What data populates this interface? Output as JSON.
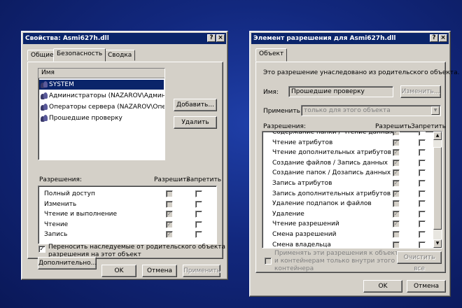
{
  "props_window": {
    "title": "Свойства: Asmi627h.dll",
    "title_buttons": [
      "?",
      "×"
    ],
    "tabs": [
      "Общие",
      "Безопасность",
      "Сводка"
    ],
    "active_tab": "Безопасность",
    "list_header": "Имя",
    "users": [
      "SYSTEM",
      "Администраторы (NAZAROV\\Администра...",
      "Операторы сервера (NAZAROV\\Оператор...",
      "Прошедшие проверку"
    ],
    "selected_user": "SYSTEM",
    "add_button": "Добавить...",
    "remove_button": "Удалить",
    "perm_label": "Разрешения:",
    "allow_label": "Разрешить",
    "deny_label": "Запретить",
    "permissions": [
      {
        "name": "Полный доступ",
        "allow": false,
        "deny": false
      },
      {
        "name": "Изменить",
        "allow": false,
        "deny": false
      },
      {
        "name": "Чтение и выполнение",
        "allow": true,
        "deny": false
      },
      {
        "name": "Чтение",
        "allow": true,
        "deny": false
      },
      {
        "name": "Запись",
        "allow": true,
        "deny": false
      }
    ],
    "advanced_button": "Дополнительно...",
    "inherit_text_line1": "Переносить наследуемые от родительского объекта",
    "inherit_text_line2": "разрешения на этот объект",
    "inherit_checked": true,
    "ok": "OK",
    "cancel": "Отмена",
    "apply": "Применить"
  },
  "perm_window": {
    "title": "Элемент разрешения для Asmi627h.dll",
    "title_buttons": [
      "?",
      "×"
    ],
    "tab": "Объект",
    "inherited_note": "Это разрешение унаследовано из родительского объекта.",
    "name_label": "Имя:",
    "name_value": "Прошедшие проверку",
    "change_button": "Изменить...",
    "apply_to_label": "Применить:",
    "apply_to_value": "только для этого объекта",
    "perm_label": "Разрешения:",
    "allow_label": "Разрешить",
    "deny_label": "Запретить",
    "permissions": [
      {
        "name": "Содержание папки / Чтение данных",
        "allow": true,
        "deny": false
      },
      {
        "name": "Чтение атрибутов",
        "allow": true,
        "deny": false
      },
      {
        "name": "Чтение дополнительных атрибутов",
        "allow": true,
        "deny": false
      },
      {
        "name": "Создание файлов / Запись данных",
        "allow": true,
        "deny": false
      },
      {
        "name": "Создание папок / Дозапись данных",
        "allow": true,
        "deny": false
      },
      {
        "name": "Запись атрибутов",
        "allow": true,
        "deny": false
      },
      {
        "name": "Запись дополнительных атрибутов",
        "allow": true,
        "deny": false
      },
      {
        "name": "Удаление подпапок и файлов",
        "allow": false,
        "deny": false
      },
      {
        "name": "Удаление",
        "allow": true,
        "deny": false
      },
      {
        "name": "Чтение разрешений",
        "allow": true,
        "deny": false
      },
      {
        "name": "Смена разрешений",
        "allow": false,
        "deny": false
      },
      {
        "name": "Смена владельца",
        "allow": false,
        "deny": false
      }
    ],
    "apply_inside_line1": "Применять эти разрешения к объектам",
    "apply_inside_line2": "и контейнерам только внутри этого",
    "apply_inside_line3": "контейнера",
    "clear_all_button": "Очистить все",
    "ok": "OK",
    "cancel": "Отмена"
  }
}
